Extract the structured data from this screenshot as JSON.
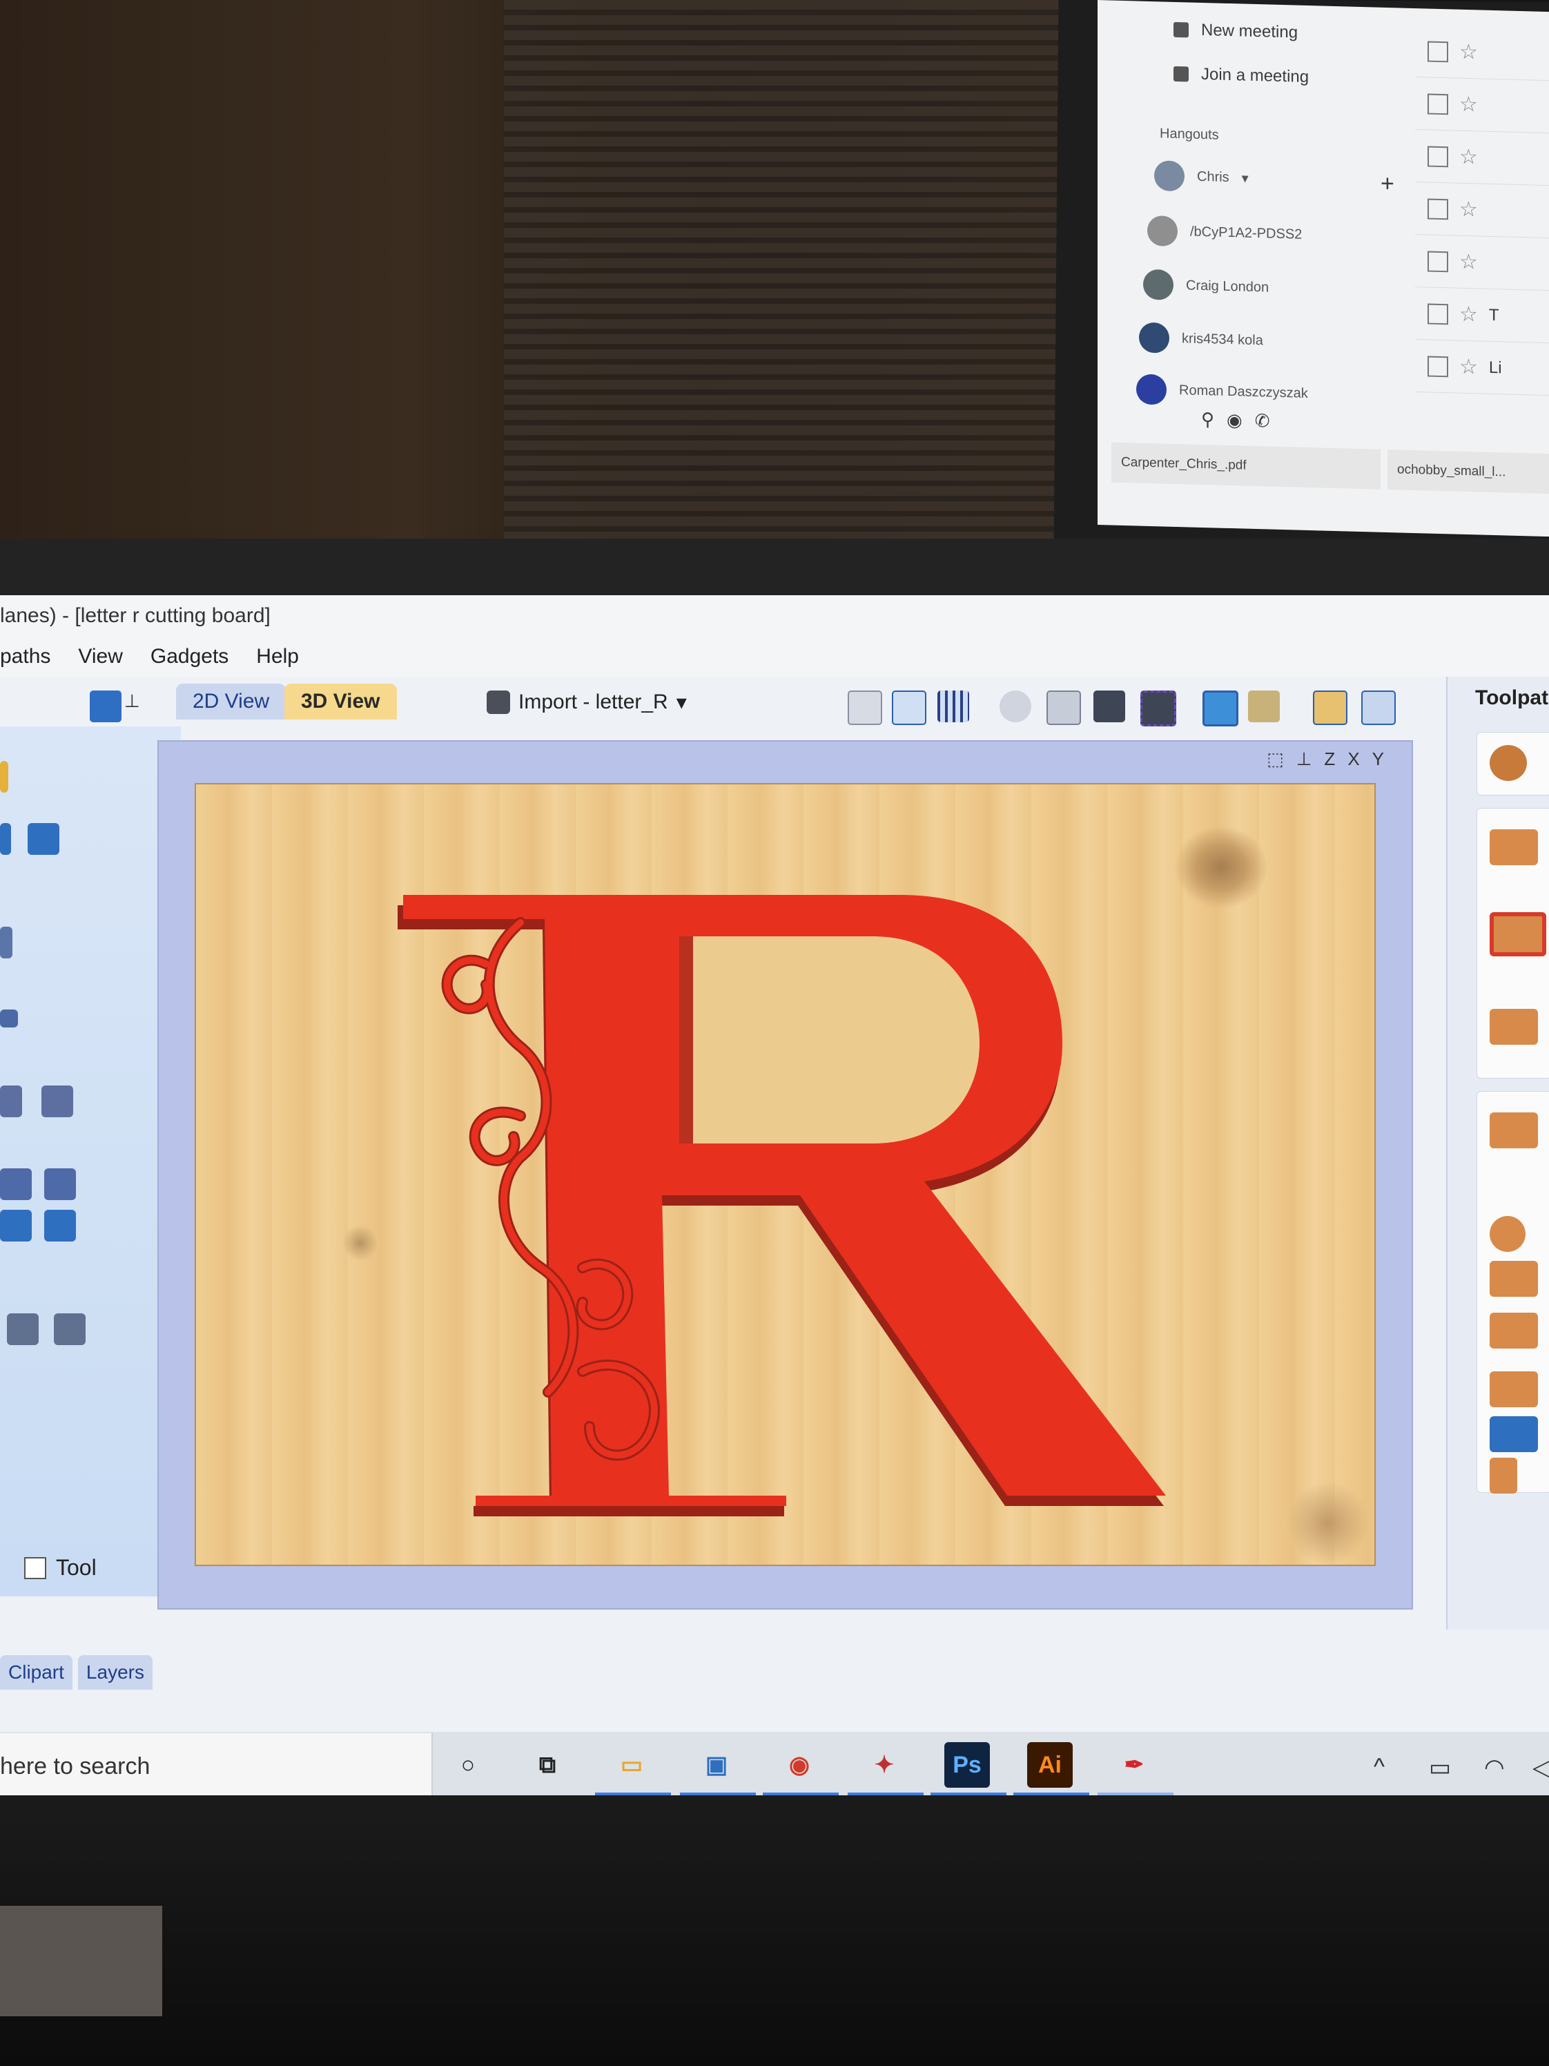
{
  "upper_monitor": {
    "menu": [
      {
        "label": "New meeting",
        "icon": "video-icon"
      },
      {
        "label": "Join a meeting",
        "icon": "keyboard-icon"
      }
    ],
    "hangouts_title": "Hangouts",
    "current_user": "Chris",
    "add_label": "+",
    "contacts": [
      {
        "name": "/bCyP1A2-PDSS2"
      },
      {
        "name": "Craig London"
      },
      {
        "name": "kris4534 kola"
      },
      {
        "name": "Roman Daszczyszak"
      }
    ],
    "downloads": [
      {
        "name": "Carpenter_Chris_.pdf"
      },
      {
        "name": "ochobby_small_l..."
      }
    ],
    "mail_rows_partial_text": [
      "",
      "",
      "",
      "",
      "",
      "T",
      "Li"
    ]
  },
  "window": {
    "title": "lanes) - [letter r cutting board]",
    "menu": [
      "paths",
      "View",
      "Gadgets",
      "Help"
    ],
    "tabs": {
      "view2d": "2D View",
      "view3d": "3D View"
    },
    "import_label": "Import - letter_R",
    "import_dropdown_icon": "▾",
    "left_tabs": [
      "Clipart",
      "Layers"
    ],
    "right_panel_title": "Toolpat",
    "right_panel_checkbox_label": "Tool",
    "viewport_axes": [
      "Z",
      "Z",
      "X",
      "Y"
    ],
    "letter": "R",
    "letter_color": "#e8301f",
    "letter_shadow_color": "#9b2217"
  },
  "taskbar": {
    "search_text": "here to search",
    "apps": [
      {
        "name": "cortana-icon",
        "glyph": "○"
      },
      {
        "name": "task-view-icon",
        "glyph": "⧉"
      },
      {
        "name": "file-explorer-icon",
        "glyph": "▭"
      },
      {
        "name": "photos-icon",
        "glyph": "▣"
      },
      {
        "name": "chrome-icon",
        "glyph": "◉"
      },
      {
        "name": "vectric-icon",
        "glyph": "✦"
      },
      {
        "name": "photoshop-icon",
        "glyph": "Ps"
      },
      {
        "name": "illustrator-icon",
        "glyph": "Ai"
      },
      {
        "name": "pen-icon",
        "glyph": "✒"
      }
    ],
    "tray": [
      "^",
      "▭",
      "◠",
      "◁"
    ]
  }
}
